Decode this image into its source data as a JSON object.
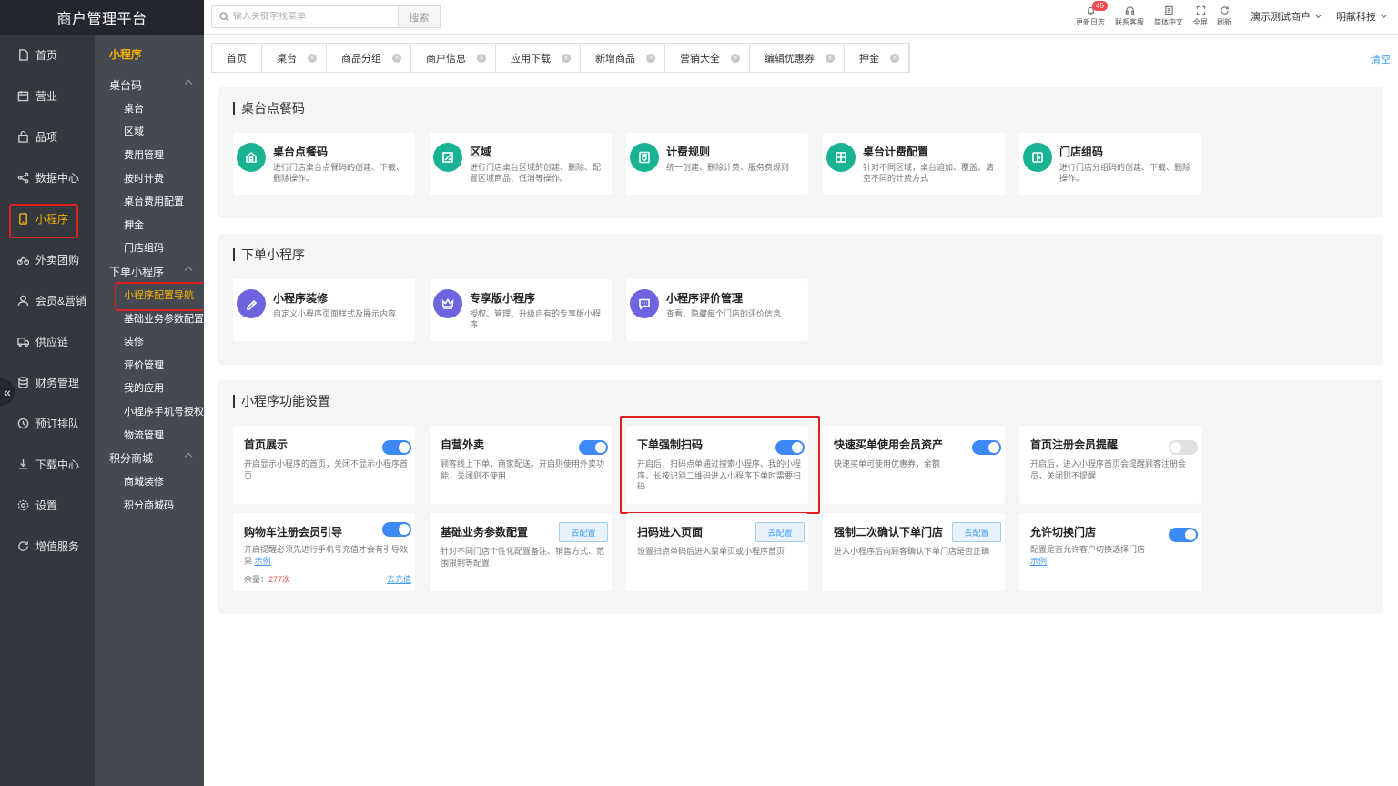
{
  "app": {
    "title": "商户管理平台"
  },
  "left_nav": [
    {
      "label": "首页",
      "icon": "document-icon"
    },
    {
      "label": "营业",
      "icon": "calendar-icon"
    },
    {
      "label": "品项",
      "icon": "bag-icon"
    },
    {
      "label": "数据中心",
      "icon": "share-icon"
    },
    {
      "label": "小程序",
      "icon": "phone-icon",
      "active": true
    },
    {
      "label": "外卖团购",
      "icon": "bike-icon"
    },
    {
      "label": "会员&营销",
      "icon": "user-icon"
    },
    {
      "label": "供应链",
      "icon": "truck-icon"
    },
    {
      "label": "财务管理",
      "icon": "database-icon"
    },
    {
      "label": "预订排队",
      "icon": "clock-icon"
    },
    {
      "label": "下载中心",
      "icon": "download-icon"
    },
    {
      "label": "设置",
      "icon": "gear-icon"
    },
    {
      "label": "增值服务",
      "icon": "refresh-icon"
    }
  ],
  "sub_nav": {
    "title": "小程序",
    "groups": [
      {
        "label": "桌台码",
        "items": [
          "桌台",
          "区域",
          "费用管理",
          "按时计费",
          "桌台费用配置",
          "押金",
          "门店组码"
        ]
      },
      {
        "label": "下单小程序",
        "items": [
          "小程序配置导航",
          "基础业务参数配置",
          "装修",
          "评价管理",
          "我的应用",
          "小程序手机号授权",
          "物流管理"
        ]
      },
      {
        "label": "积分商城",
        "items": [
          "商城装修",
          "积分商城码"
        ]
      }
    ],
    "active_item": "小程序配置导航"
  },
  "topbar": {
    "search_placeholder": "输入关键字找菜单",
    "search_button": "搜索",
    "tools": [
      {
        "label": "更新日志",
        "icon": "bell-icon",
        "badge": "45"
      },
      {
        "label": "联系客服",
        "icon": "headset-icon"
      },
      {
        "label": "简体中文",
        "icon": "translate-icon"
      },
      {
        "label": "全屏",
        "icon": "fullscreen-icon"
      },
      {
        "label": "刷新",
        "icon": "refresh-icon"
      }
    ],
    "merchant": "演示测试商户",
    "company": "明献科技"
  },
  "tabs": [
    {
      "label": "首页",
      "closable": false
    },
    {
      "label": "桌台",
      "closable": true
    },
    {
      "label": "商品分组",
      "closable": true
    },
    {
      "label": "商户信息",
      "closable": true
    },
    {
      "label": "应用下载",
      "closable": true
    },
    {
      "label": "新增商品",
      "closable": true
    },
    {
      "label": "营销大全",
      "closable": true
    },
    {
      "label": "编辑优惠券",
      "closable": true
    },
    {
      "label": "押金",
      "closable": true
    }
  ],
  "tabs_clear": "清空",
  "sections": {
    "s1": {
      "title": "桌台点餐码",
      "cards": [
        {
          "title": "桌台点餐码",
          "desc": "进行门店桌台点餐码的创建、下载、删除操作。",
          "icon": "qrcode-icon",
          "color": "#19b394"
        },
        {
          "title": "区域",
          "desc": "进行门店桌台区域的创建、删除、配置区域商品、低消等操作。",
          "icon": "area-icon",
          "color": "#19b394"
        },
        {
          "title": "计费规则",
          "desc": "统一创建、删除计费、服务费规则",
          "icon": "billing-icon",
          "color": "#19b394"
        },
        {
          "title": "桌台计费配置",
          "desc": "针对不同区域，桌台追加、覆盖、清空不同的计费方式",
          "icon": "table-icon",
          "color": "#19b394"
        },
        {
          "title": "门店组码",
          "desc": "进行门店分组码的创建、下载、删除操作。",
          "icon": "group-icon",
          "color": "#19b394"
        }
      ]
    },
    "s2": {
      "title": "下单小程序",
      "cards": [
        {
          "title": "小程序装修",
          "desc": "自定义小程序页面样式及展示内容",
          "icon": "brush-icon",
          "color": "#6f64e0"
        },
        {
          "title": "专享版小程序",
          "desc": "授权、管理、升级自有的专享版小程序",
          "icon": "crown-icon",
          "color": "#6f64e0"
        },
        {
          "title": "小程序评价管理",
          "desc": "查看、隐藏每个门店的评价信息",
          "icon": "comment-icon",
          "color": "#6f64e0"
        }
      ]
    },
    "s3": {
      "title": "小程序功能设置",
      "row1": [
        {
          "title": "首页展示",
          "desc": "开启显示小程序的首页，关闭不显示小程序首页",
          "on": true
        },
        {
          "title": "自营外卖",
          "desc": "顾客线上下单，商家配送。开启则使用外卖功能，关闭则不使用",
          "on": true
        },
        {
          "title": "下单强制扫码",
          "desc": "开启后，扫码点单通过搜索小程序、我的小程序、长按识别二维码进入小程序下单时需要扫码",
          "on": true
        },
        {
          "title": "快速买单使用会员资产",
          "desc": "快速买单可使用优惠券，余额",
          "on": true
        },
        {
          "title": "首页注册会员提醒",
          "desc": "开启后，进入小程序首页会提醒顾客注册会员，关闭则不提醒",
          "on": false
        }
      ],
      "row2": {
        "c1": {
          "title": "购物车注册会员引导",
          "desc": "开启提醒必须先进行手机号充值才会有引导效果",
          "link": "示例",
          "remain_label": "余量：",
          "remain_value": "277次",
          "recharge": "去充值",
          "on": true
        },
        "c2": {
          "title": "基础业务参数配置",
          "desc": "针对不同门店个性化配置备注、销售方式、范围限制等配置",
          "button": "去配置"
        },
        "c3": {
          "title": "扫码进入页面",
          "desc": "设置扫点单码后进入菜单页或小程序首页",
          "button": "去配置"
        },
        "c4": {
          "title": "强制二次确认下单门店",
          "desc": "进入小程序后向顾客确认下单门店是否正确",
          "button": "去配置"
        },
        "c5": {
          "title": "允许切换门店",
          "desc": "配置是否允许客户切换选择门店",
          "link": "示例",
          "on": true
        }
      }
    }
  },
  "colors": {
    "accent": "#f5b400",
    "primary": "#3d8af7",
    "highlight": "#e02020",
    "nav_bg": "#33373e",
    "subnav_bg": "#454a52"
  }
}
